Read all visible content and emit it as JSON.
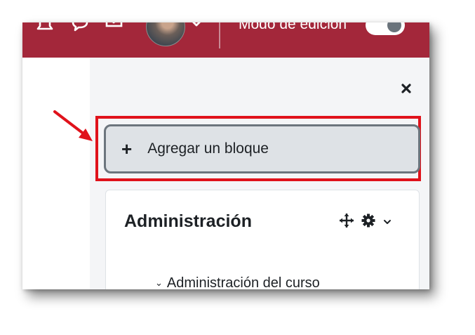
{
  "navbar": {
    "background": "#a3273a",
    "edit_mode_label": "Modo de edición",
    "edit_mode_on": false,
    "icons": [
      "bell-icon",
      "chat-icon",
      "mail-icon",
      "chevron-down-icon"
    ]
  },
  "drawer": {
    "close_icon": "close-icon",
    "add_block_label": "Agregar un bloque",
    "add_block_icon": "plus-icon",
    "highlight_color": "#e0121b"
  },
  "admin_block": {
    "title": "Administración",
    "submenu_label": "Administración del curso",
    "controls": [
      "move-icon",
      "gear-icon",
      "chevron-down-icon"
    ]
  },
  "annotation": {
    "arrow_color": "#e0121b"
  }
}
